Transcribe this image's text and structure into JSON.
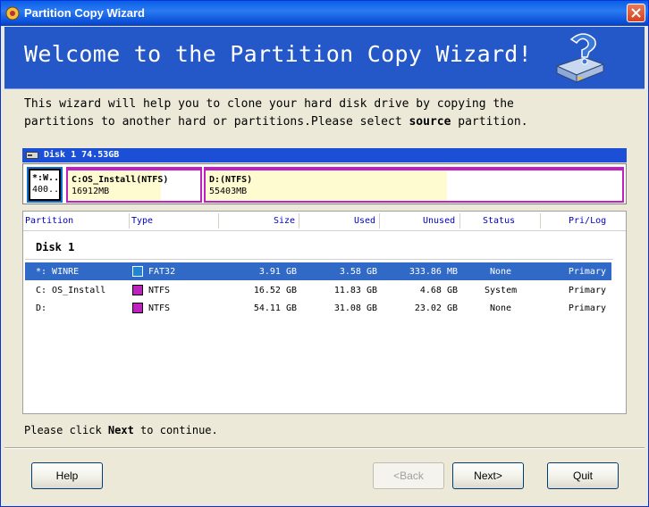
{
  "window": {
    "title": "Partition Copy Wizard"
  },
  "header": {
    "heading": "Welcome to the Partition Copy Wizard!"
  },
  "intro": {
    "line1": "This wizard will help you to clone your hard disk drive by copying the",
    "line2_prefix": "partitions to another hard or partitions.Please select ",
    "line2_bold": "source",
    "line2_suffix": " partition."
  },
  "disk_map": {
    "disk_label": "Disk 1  74.53GB",
    "partitions": [
      {
        "name": "*:W..",
        "size": "400..",
        "used_fraction": 0.92
      },
      {
        "name": "C:OS_Install(NTFS)",
        "size": "16912MB",
        "used_fraction": 0.72
      },
      {
        "name": "D:(NTFS)",
        "size": "55403MB",
        "used_fraction": 0.57
      }
    ]
  },
  "table": {
    "columns": [
      "Partition",
      "Type",
      "Size",
      "Used",
      "Unused",
      "Status",
      "Pri/Log"
    ],
    "disk_group": "Disk 1",
    "rows": [
      {
        "partition": "*: WINRE",
        "type": "FAT32",
        "size": "3.91 GB",
        "used": "3.58 GB",
        "unused": "333.86 MB",
        "status": "None",
        "prilog": "Primary",
        "swatch": "#1c86d8"
      },
      {
        "partition": "C: OS_Install",
        "type": "NTFS",
        "size": "16.52 GB",
        "used": "11.83 GB",
        "unused": "4.68 GB",
        "status": "System",
        "prilog": "Primary",
        "swatch": "#c020c0"
      },
      {
        "partition": "D:",
        "type": "NTFS",
        "size": "54.11 GB",
        "used": "31.08 GB",
        "unused": "23.02 GB",
        "status": "None",
        "prilog": "Primary",
        "swatch": "#c020c0"
      }
    ]
  },
  "footer": {
    "prefix": "Please click ",
    "bold": "Next",
    "suffix": " to continue."
  },
  "buttons": {
    "help": "Help",
    "back": "<Back",
    "next": "Next>",
    "quit": "Quit"
  },
  "colors": {
    "titlebar": "#0a5fe8",
    "header": "#2457c8",
    "selection": "#3169c6",
    "ntfs": "#c020c0",
    "fat32": "#1c86d8"
  }
}
